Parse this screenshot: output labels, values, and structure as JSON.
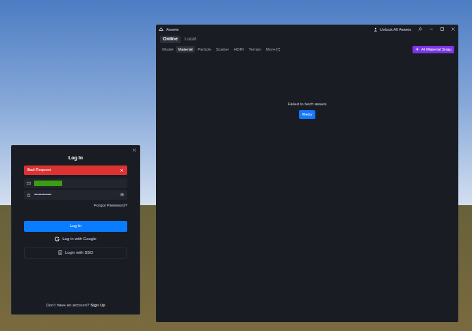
{
  "assets_window": {
    "title": "Assets",
    "unlock": "Unlock All Assets",
    "source_tabs": [
      {
        "label": "Online",
        "selected": true
      },
      {
        "label": "Local",
        "selected": false
      }
    ],
    "category_tabs": [
      {
        "label": "Model",
        "selected": false,
        "external": false
      },
      {
        "label": "Material",
        "selected": true,
        "external": false
      },
      {
        "label": "Particle",
        "selected": false,
        "external": false
      },
      {
        "label": "Scatter",
        "selected": false,
        "external": false
      },
      {
        "label": "HDRI",
        "selected": false,
        "external": false
      },
      {
        "label": "Terrain",
        "selected": false,
        "external": false
      },
      {
        "label": "More",
        "selected": false,
        "external": true
      }
    ],
    "ai_button": "AI Material Snap",
    "message": "Failed to fetch assets",
    "retry": "Retry"
  },
  "login_dialog": {
    "title": "Log In",
    "error": "Bad Request",
    "email": {
      "redacted": true
    },
    "password": {
      "value": "••••••••••••"
    },
    "forgot": "Forgot Password?",
    "submit": "Log In",
    "google": "Log in with Google",
    "sso": "Login with SSO",
    "signup_prompt": "Don't have an account?",
    "signup_link": "Sign Up"
  }
}
